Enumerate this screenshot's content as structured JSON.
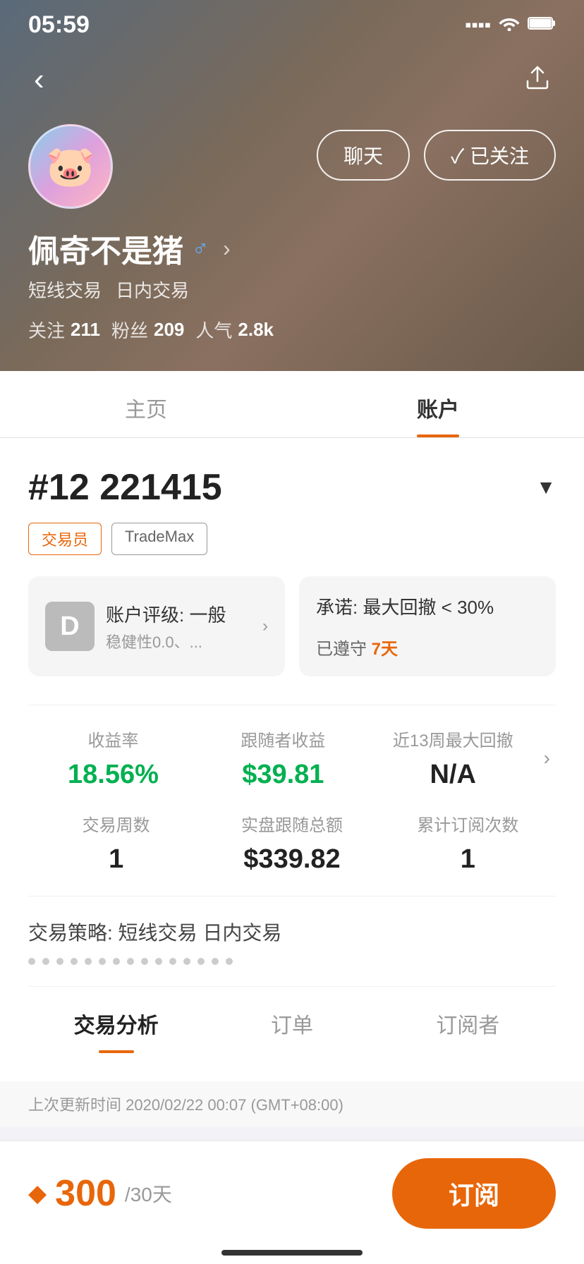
{
  "statusBar": {
    "time": "05:59"
  },
  "header": {
    "backLabel": "‹",
    "shareLabel": "⬆",
    "avatarEmoji": "🐷",
    "chatLabel": "聊天",
    "followedLabel": "✓ 已关注",
    "name": "佩奇不是猪",
    "genderIcon": "♂",
    "tags": [
      "短线交易",
      "日内交易"
    ],
    "stats": {
      "followingLabel": "关注",
      "followingValue": "211",
      "fansLabel": "粉丝",
      "fansValue": "209",
      "popularityLabel": "人气",
      "popularityValue": "2.8k"
    }
  },
  "tabs": {
    "mainTab": "主页",
    "accountTab": "账户"
  },
  "account": {
    "id": "#12  221415",
    "dropdownArrow": "▼",
    "badges": {
      "traderLabel": "交易员",
      "platformLabel": "TradeMax"
    },
    "gradeCard": {
      "letter": "D",
      "title": "账户评级: 一般",
      "subtitle": "稳健性0.0、...",
      "arrow": "›"
    },
    "promiseCard": {
      "title": "承诺: 最大回撤 < 30%",
      "subtitle": "已遵守",
      "daysValue": "7天"
    },
    "stats": {
      "row1": [
        {
          "label": "收益率",
          "value": "18.56%",
          "color": "green"
        },
        {
          "label": "跟随者收益",
          "value": "$39.81",
          "color": "green"
        },
        {
          "label": "近13周最大回撤",
          "value": "N/A",
          "color": "black"
        }
      ],
      "row2": [
        {
          "label": "交易周数",
          "value": "1",
          "color": "black"
        },
        {
          "label": "实盘跟随总额",
          "value": "$339.82",
          "color": "black"
        },
        {
          "label": "累计订阅次数",
          "value": "1",
          "color": "black"
        }
      ]
    },
    "strategy": {
      "label": "交易策略: 短线交易 日内交易",
      "dots": 15
    }
  },
  "analysisTabs": {
    "tab1": "交易分析",
    "tab2": "订单",
    "tab3": "订阅者"
  },
  "updateTime": "上次更新时间 2020/02/22 00:07 (GMT+08:00)",
  "bottomBar": {
    "diamondIcon": "◆",
    "price": "300",
    "period": "/30天",
    "subscribeLabel": "订阅"
  }
}
